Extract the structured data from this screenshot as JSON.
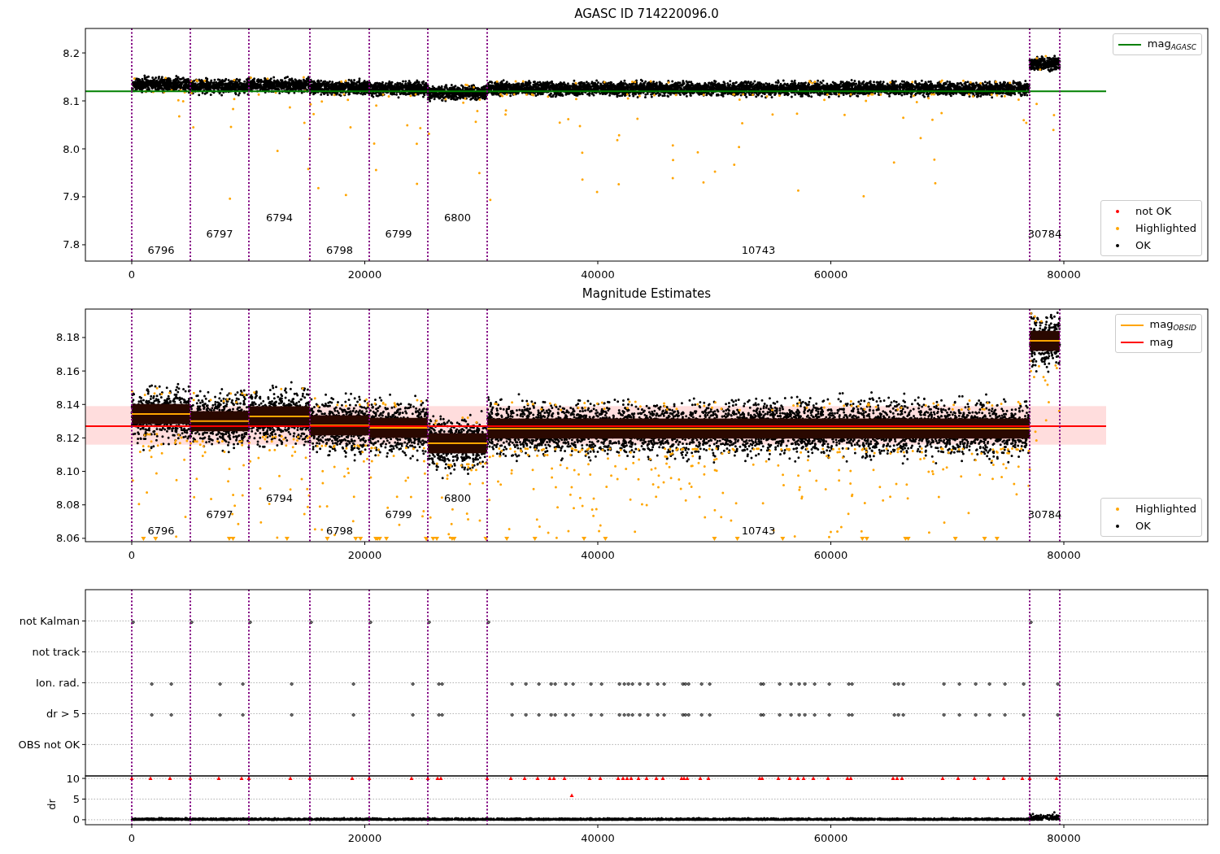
{
  "figure": {
    "panels": [
      {
        "chart_data": {
          "type": "scatter",
          "title": "AGASC ID 714220096.0",
          "xlim": [
            -3979,
            92356
          ],
          "ylim": [
            7.766,
            8.251
          ],
          "xticks": [
            0,
            20000,
            40000,
            60000,
            80000
          ],
          "yticks": [
            {
              "value": 7.8,
              "label": "7.8"
            },
            {
              "value": 7.9,
              "label": "7.9"
            },
            {
              "value": 8.0,
              "label": "8.0"
            },
            {
              "value": 8.1,
              "label": "8.1"
            },
            {
              "value": 8.2,
              "label": "8.2"
            }
          ],
          "legend": true,
          "series": [
            {
              "name": "mag$_{AGASC}$",
              "type": "line",
              "color": "#008000",
              "x": [
                -3979,
                83630
              ],
              "values": [
                8.12,
                8.12
              ]
            }
          ],
          "ref_lines": [
            {
              "axis": "x",
              "value": 0
            },
            {
              "axis": "x",
              "value": 5026
            },
            {
              "axis": "x",
              "value": 10052
            },
            {
              "axis": "x",
              "value": 15288
            },
            {
              "axis": "x",
              "value": 20384
            },
            {
              "axis": "x",
              "value": 25410
            },
            {
              "axis": "x",
              "value": 30506
            },
            {
              "axis": "x",
              "value": 77068
            },
            {
              "axis": "x",
              "value": 79651
            }
          ],
          "annotations": [
            "6796",
            "6797",
            "6794",
            "6798",
            "6799",
            "6800",
            "10743",
            "30784"
          ]
        },
        "legend": [
          {
            "label": "not OK",
            "color": "#ff0000"
          },
          {
            "label": "Highlighted",
            "color": "#ffa500"
          },
          {
            "label": "OK",
            "color": "#000000"
          }
        ]
      },
      {
        "chart_data": {
          "type": "scatter",
          "title": "Magnitude Estimates",
          "xlim": [
            -3979,
            92356
          ],
          "ylim": [
            8.058,
            8.197
          ],
          "xticks": [
            0,
            20000,
            40000,
            60000,
            80000
          ],
          "yticks": [
            {
              "value": 8.06,
              "label": "8.06"
            },
            {
              "value": 8.08,
              "label": "8.08"
            },
            {
              "value": 8.1,
              "label": "8.10"
            },
            {
              "value": 8.12,
              "label": "8.12"
            },
            {
              "value": 8.14,
              "label": "8.14"
            },
            {
              "value": 8.16,
              "label": "8.16"
            },
            {
              "value": 8.18,
              "label": "8.18"
            }
          ],
          "legend": true,
          "series": [
            {
              "name": "mag$_{OBSID}$",
              "type": "line",
              "color": "#ffa500",
              "x": [
                0,
                5026
              ],
              "values": [
                8.1343,
                8.1343
              ]
            },
            {
              "type": "line",
              "color": "#ffa500",
              "x": [
                5026,
                10052
              ],
              "values": [
                8.13,
                8.13
              ]
            },
            {
              "type": "line",
              "color": "#ffa500",
              "x": [
                10052,
                15288
              ],
              "values": [
                8.1329,
                8.1329
              ]
            },
            {
              "type": "line",
              "color": "#ffa500",
              "x": [
                15288,
                20384
              ],
              "values": [
                8.1275,
                8.1275
              ]
            },
            {
              "type": "line",
              "color": "#ffa500",
              "x": [
                20384,
                25410
              ],
              "values": [
                8.126,
                8.126
              ]
            },
            {
              "type": "line",
              "color": "#ffa500",
              "x": [
                25410,
                30506
              ],
              "values": [
                8.1168,
                8.1168
              ]
            },
            {
              "type": "line",
              "color": "#ffa500",
              "x": [
                30506,
                77068
              ],
              "values": [
                8.1256,
                8.1256
              ]
            },
            {
              "type": "line",
              "color": "#ffa500",
              "x": [
                77068,
                79651
              ],
              "values": [
                8.178,
                8.178
              ]
            },
            {
              "name": "mag",
              "type": "line",
              "color": "#ff0000",
              "x": [
                -3979,
                83630
              ],
              "values": [
                8.127,
                8.127
              ]
            }
          ],
          "bands": [
            {
              "axis": "y",
              "from": 8.116,
              "to": 8.139
            }
          ],
          "ref_lines": [
            {
              "axis": "x",
              "value": 0
            },
            {
              "axis": "x",
              "value": 5026
            },
            {
              "axis": "x",
              "value": 10052
            },
            {
              "axis": "x",
              "value": 15288
            },
            {
              "axis": "x",
              "value": 20384
            },
            {
              "axis": "x",
              "value": 25410
            },
            {
              "axis": "x",
              "value": 30506
            },
            {
              "axis": "x",
              "value": 77068
            },
            {
              "axis": "x",
              "value": 79651
            }
          ],
          "annotations": [
            "6796",
            "6797",
            "6794",
            "6798",
            "6799",
            "6800",
            "10743",
            "30784"
          ]
        },
        "legend": [
          {
            "label": "Highlighted",
            "color": "#ffa500"
          },
          {
            "label": "OK",
            "color": "#000000"
          }
        ]
      },
      {
        "flag_rows": [
          "not Kalman",
          "not track",
          "Ion. rad.",
          "dr > 5",
          "OBS not OK"
        ]
      },
      {
        "chart_data": {
          "type": "scatter",
          "grid": true,
          "ylabel": "dr",
          "xlim": [
            -3979,
            92356
          ],
          "ylim": [
            -1.2,
            10.6
          ],
          "xticks": [
            0,
            20000,
            40000,
            60000,
            80000
          ],
          "yticks": [
            {
              "value": 0,
              "label": "0"
            },
            {
              "value": 5,
              "label": "5"
            },
            {
              "value": 10,
              "label": "10"
            }
          ],
          "series": [
            {
              "type": "scatter",
              "color": "#ff0000",
              "x": [
                0,
                5026,
                10052,
                15288,
                20384,
                25410,
                30506,
                1606,
                3281,
                7469,
                9424,
                13613,
                18918,
                24015,
                26248,
                26527,
                32531,
                33718,
                34835,
                35882,
                36231,
                37138,
                37767,
                39302,
                40210,
                41746,
                42165,
                42513,
                42862,
                43491,
                44189,
                45026,
                45585,
                47190,
                47400,
                47679,
                48796,
                49494,
                53892,
                54101,
                55497,
                56475,
                57173,
                57661,
                58499,
                59756,
                61431,
                61710,
                65340,
                65689,
                66108,
                69598,
                70925,
                72321,
                73508,
                74834,
                76440,
                77068,
                79372
              ],
              "values": [
                10,
                10,
                10,
                10,
                10,
                10,
                10,
                10,
                10,
                10,
                10,
                10,
                10,
                10,
                10,
                10,
                10,
                10,
                10,
                10,
                10,
                10,
                5.9,
                10,
                10,
                10,
                10,
                10,
                10,
                10,
                10,
                10,
                10,
                10,
                10,
                10,
                10,
                10,
                10,
                10,
                10,
                10,
                10,
                10,
                10,
                10,
                10,
                10,
                10,
                10,
                10,
                10,
                10,
                10,
                10,
                10,
                10,
                10,
                10
              ]
            }
          ],
          "ref_lines": [
            {
              "axis": "x",
              "value": 0
            },
            {
              "axis": "x",
              "value": 5026
            },
            {
              "axis": "x",
              "value": 10052
            },
            {
              "axis": "x",
              "value": 15288
            },
            {
              "axis": "x",
              "value": 20384
            },
            {
              "axis": "x",
              "value": 25410
            },
            {
              "axis": "x",
              "value": 30506
            },
            {
              "axis": "x",
              "value": 77068
            },
            {
              "axis": "x",
              "value": 79651
            }
          ]
        }
      }
    ]
  }
}
